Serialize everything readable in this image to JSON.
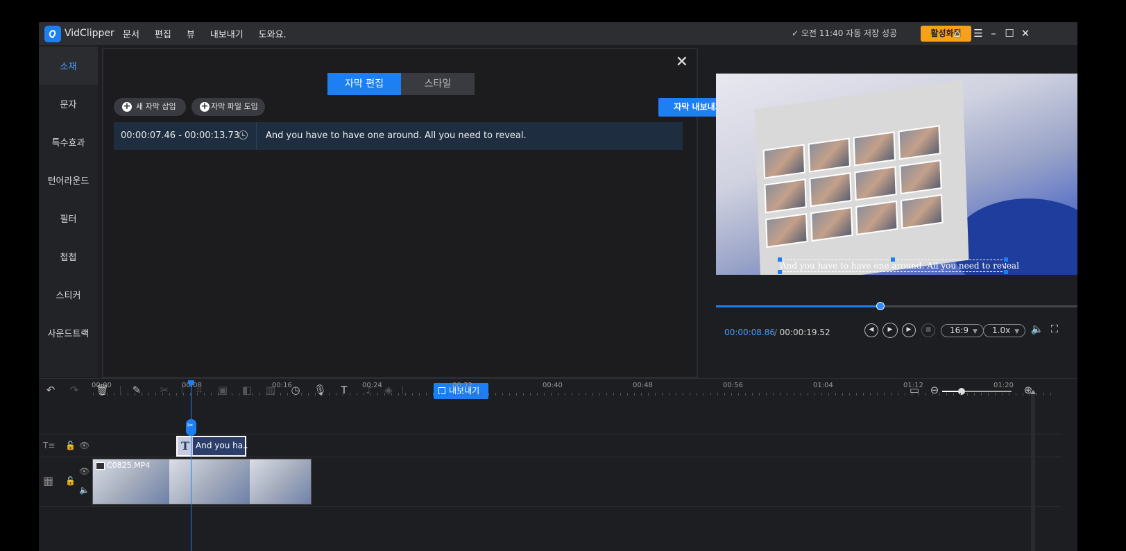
{
  "title_bar": {
    "app_name": "VidClipper",
    "menu": [
      "문서",
      "편집",
      "뷰",
      "내보내기",
      "도와요."
    ],
    "autosave_status": "✓ 오전 11:40 자동 저장 성공",
    "activate_label": "활성화됨",
    "icons": [
      "home-icon",
      "hamburger-menu-icon",
      "minimize-icon",
      "maximize-icon",
      "close-icon"
    ]
  },
  "sidebar": {
    "items": [
      {
        "label": "소재",
        "active": true
      },
      {
        "label": "문자"
      },
      {
        "label": "특수효과"
      },
      {
        "label": "턴어라운드"
      },
      {
        "label": "필터"
      },
      {
        "label": "첩첩"
      },
      {
        "label": "스티커"
      },
      {
        "label": "사운드트랙"
      }
    ]
  },
  "subtitle_panel": {
    "tabs": [
      {
        "label": "자막 편집",
        "active": true
      },
      {
        "label": "스타일"
      }
    ],
    "insert_subtitle": "새 자막 삽입",
    "import_subtitle_file": "자막 파일 도입",
    "export_subtitle": "자막 내보내기",
    "rows": [
      {
        "time": "00:00:07.46 - 00:00:13.73",
        "text": "And you have to have one around. All you need to reveal."
      }
    ]
  },
  "preview": {
    "overlay_subtitle": "And you have to have one around. All you need to reveal",
    "current_time": "00:00:08.86",
    "separator": " / ",
    "total_time": "00:00:19.52",
    "progress_fraction": 0.4549,
    "aspect_ratio": "16:9",
    "speed": "1.0x",
    "controls": [
      "prev-frame-icon",
      "play-icon",
      "next-frame-icon",
      "stop-icon",
      "volume-icon",
      "fullscreen-icon"
    ]
  },
  "toolbar": {
    "export_label": "내보내기",
    "tools": [
      "undo-icon",
      "redo-icon",
      "delete-icon",
      "edit-icon",
      "scissors-icon",
      "crop-icon",
      "mosaic-icon",
      "freeze-icon",
      "chart-icon",
      "speed-icon",
      "record-icon",
      "text-to-speech-icon",
      "voice-change-icon",
      "add-marker-icon"
    ],
    "zoom_level_fraction": 0.28
  },
  "timeline": {
    "ruler_labels": [
      "00:00",
      "00:08",
      "00:16",
      "00:24",
      "00:32",
      "00:40",
      "00:48",
      "00:56",
      "01:04",
      "01:12",
      "01:20"
    ],
    "playhead_time": "00:08.86",
    "text_clip_label": "And you ha..",
    "video_clip_name": "C0825.MP4"
  },
  "colors": {
    "accent": "#1e7ff2",
    "activate": "#f7a11b",
    "background": "#1d1e21",
    "title_bar": "#2d2e32"
  }
}
